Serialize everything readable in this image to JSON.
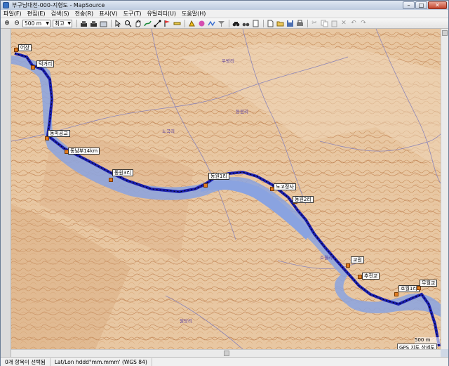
{
  "window": {
    "title": "부구남대천-000-지형도 - MapSource",
    "min_label": "–",
    "max_label": "□",
    "close_label": "✕"
  },
  "menu": [
    {
      "label": "파일(F)"
    },
    {
      "label": "편집(E)"
    },
    {
      "label": "검색(S)"
    },
    {
      "label": "전송(R)"
    },
    {
      "label": "표시(V)"
    },
    {
      "label": "도구(T)"
    },
    {
      "label": "유틸리티(U)"
    },
    {
      "label": "도움말(H)"
    }
  ],
  "toolbar": {
    "zoom_in_icon": "⊕",
    "zoom_out_icon": "⊖",
    "scale_value": "500 m",
    "detail_value": "최고"
  },
  "map": {
    "scale_label": "500 m",
    "overlay_label": "GPS 지도 상세도",
    "waypoints": [
      {
        "label": "어상"
      },
      {
        "label": "덕거리"
      },
      {
        "label": "동미공교"
      },
      {
        "label": "동남부14km"
      },
      {
        "label": "동원3리"
      },
      {
        "label": "동원1리"
      },
      {
        "label": "노고정사"
      },
      {
        "label": "동원2리"
      },
      {
        "label": "교원"
      },
      {
        "label": "추전교"
      },
      {
        "label": "호월1리"
      },
      {
        "label": "무월교"
      }
    ],
    "towns": [
      {
        "label": "노곡리"
      },
      {
        "label": "우방리"
      },
      {
        "label": "호월리"
      },
      {
        "label": "동원리"
      },
      {
        "label": "원당리"
      }
    ]
  },
  "status": {
    "selection": "0개 항목이 선택됨",
    "coords": "Lat/Lon hddd°mm.mmm' (WGS 84)"
  }
}
